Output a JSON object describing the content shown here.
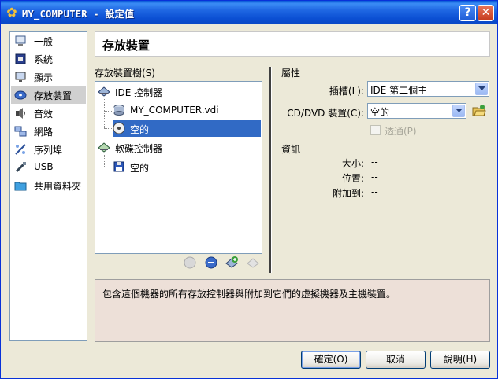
{
  "window": {
    "title": "MY_COMPUTER - 設定值",
    "help_glyph": "?",
    "close_glyph": "✕"
  },
  "sidebar": {
    "items": [
      {
        "label": "一般",
        "icon": "monitor-general-icon"
      },
      {
        "label": "系統",
        "icon": "system-chip-icon"
      },
      {
        "label": "顯示",
        "icon": "display-icon"
      },
      {
        "label": "存放裝置",
        "icon": "storage-disk-icon",
        "selected": true
      },
      {
        "label": "音效",
        "icon": "audio-speaker-icon"
      },
      {
        "label": "網路",
        "icon": "network-icon"
      },
      {
        "label": "序列埠",
        "icon": "serial-port-icon"
      },
      {
        "label": "USB",
        "icon": "usb-icon"
      },
      {
        "label": "共用資料夾",
        "icon": "shared-folder-icon"
      }
    ]
  },
  "page": {
    "title": "存放裝置",
    "tree_label": "存放裝置樹(S)",
    "tree": {
      "ide_controller": "IDE 控制器",
      "ide_disk": "MY_COMPUTER.vdi",
      "ide_cd": "空的",
      "floppy_controller": "軟碟控制器",
      "floppy_drive": "空的"
    },
    "attributes": {
      "section": "屬性",
      "slot_label": "插槽(L):",
      "slot_value": "IDE 第二個主",
      "cd_label": "CD/DVD 裝置(C):",
      "cd_value": "空的",
      "passthrough_label": "透通(P)"
    },
    "info": {
      "section": "資訊",
      "size_label": "大小:",
      "size_value": "--",
      "location_label": "位置:",
      "location_value": "--",
      "attached_label": "附加到:",
      "attached_value": "--"
    },
    "description": "包含這個機器的所有存放控制器與附加到它們的虛擬機器及主機裝置。"
  },
  "buttons": {
    "ok": "確定(O)",
    "cancel": "取消",
    "help": "說明(H)"
  },
  "colors": {
    "selection": "#316ac5",
    "titlebar": "#0b4fd3",
    "description_bg": "#ede0d8"
  }
}
